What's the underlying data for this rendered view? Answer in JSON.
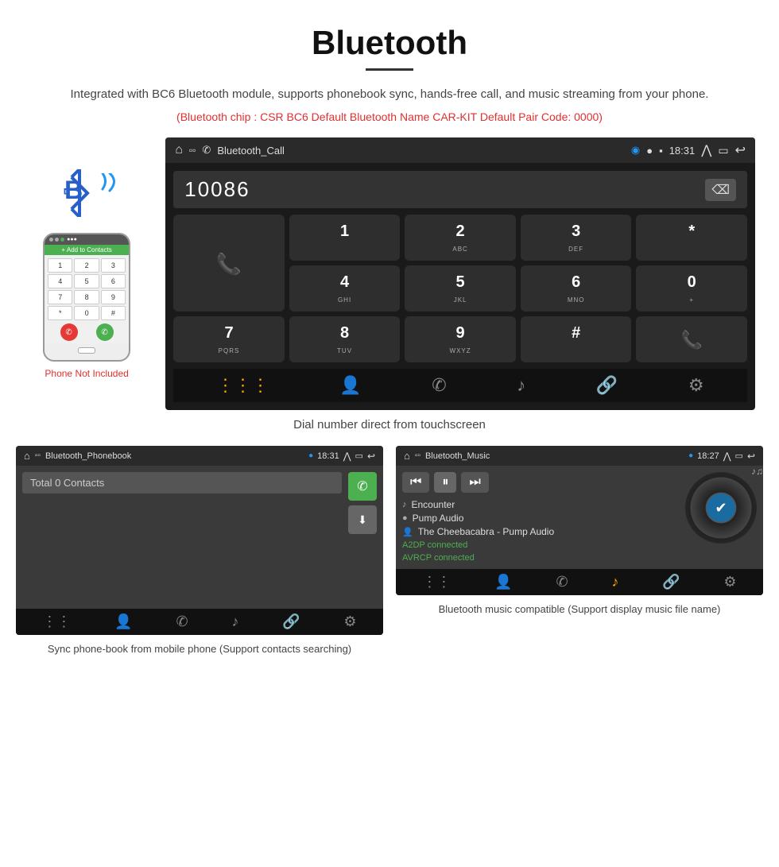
{
  "header": {
    "title": "Bluetooth",
    "subtitle": "Integrated with BC6 Bluetooth module, supports phonebook sync, hands-free call, and music streaming from your phone.",
    "chip_info": "(Bluetooth chip : CSR BC6    Default Bluetooth Name CAR-KIT    Default Pair Code: 0000)"
  },
  "phone_aside": {
    "not_included": "Phone Not Included"
  },
  "car_screen": {
    "topbar_title": "Bluetooth_Call",
    "time": "18:31",
    "dial_number": "10086",
    "keys": [
      {
        "main": "1",
        "sub": ""
      },
      {
        "main": "2",
        "sub": "ABC"
      },
      {
        "main": "3",
        "sub": "DEF"
      },
      {
        "main": "*",
        "sub": ""
      },
      {
        "main": "4",
        "sub": "GHI"
      },
      {
        "main": "5",
        "sub": "JKL"
      },
      {
        "main": "6",
        "sub": "MNO"
      },
      {
        "main": "0",
        "sub": "+"
      },
      {
        "main": "7",
        "sub": "PQRS"
      },
      {
        "main": "8",
        "sub": "TUV"
      },
      {
        "main": "9",
        "sub": "WXYZ"
      },
      {
        "main": "#",
        "sub": ""
      }
    ]
  },
  "main_caption": "Dial number direct from touchscreen",
  "phonebook_screen": {
    "topbar_title": "Bluetooth_Phonebook",
    "time": "18:31",
    "search_placeholder": "Total 0 Contacts"
  },
  "phonebook_caption": "Sync phone-book from mobile phone\n(Support contacts searching)",
  "music_screen": {
    "topbar_title": "Bluetooth_Music",
    "time": "18:27",
    "tracks": [
      {
        "icon": "♪",
        "label": "Encounter"
      },
      {
        "icon": "●",
        "label": "Pump Audio"
      },
      {
        "icon": "👤",
        "label": "The Cheebacabra - Pump Audio"
      }
    ],
    "status1": "A2DP connected",
    "status2": "AVRCP connected"
  },
  "music_caption": "Bluetooth music compatible\n(Support display music file name)"
}
